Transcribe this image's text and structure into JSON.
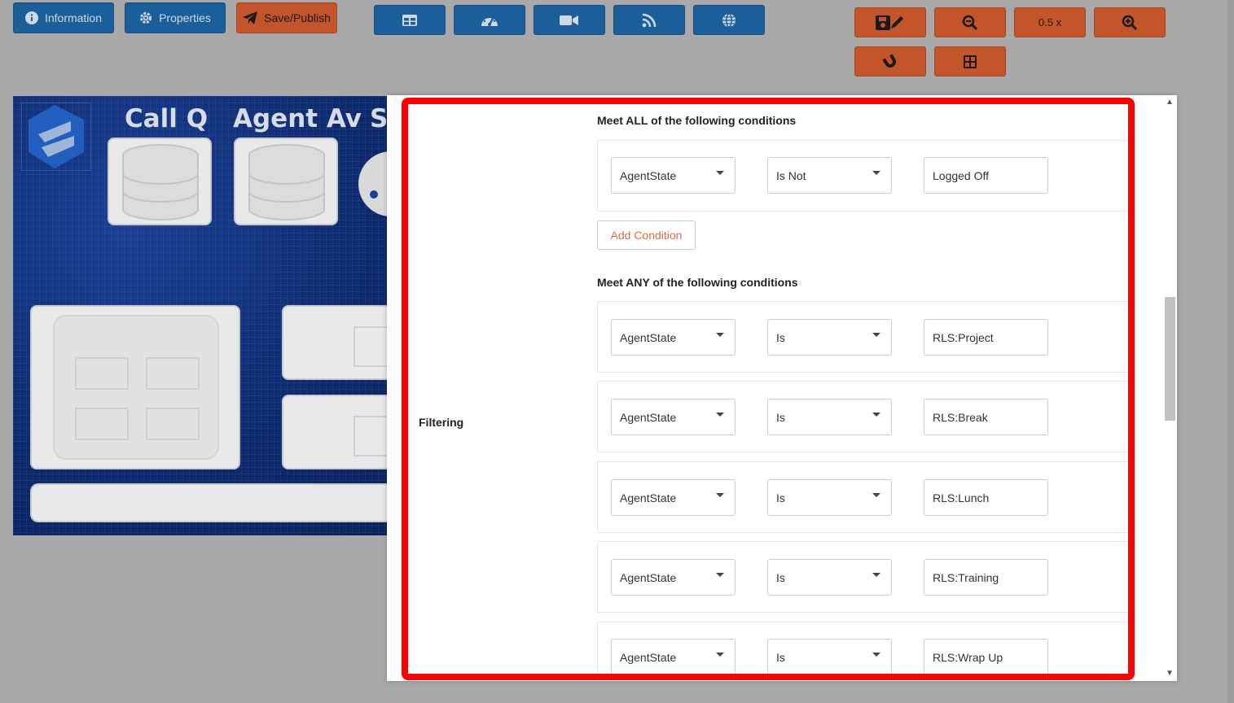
{
  "toolbar": {
    "information_label": "Information",
    "properties_label": "Properties",
    "save_publish_label": "Save/Publish",
    "zoom_level": "0.5 x"
  },
  "canvas": {
    "widget1_title": "Call Q",
    "widget2_title": "Agent Av",
    "widget3_title": "S"
  },
  "modal": {
    "filtering_label": "Filtering",
    "all_heading": "Meet ALL of the following conditions",
    "any_heading": "Meet ANY of the following conditions",
    "add_condition_label": "Add Condition",
    "all_conditions": [
      {
        "field": "AgentState",
        "operator": "Is Not",
        "value": "Logged Off"
      }
    ],
    "any_conditions": [
      {
        "field": "AgentState",
        "operator": "Is",
        "value": "RLS:Project"
      },
      {
        "field": "AgentState",
        "operator": "Is",
        "value": "RLS:Break"
      },
      {
        "field": "AgentState",
        "operator": "Is",
        "value": "RLS:Lunch"
      },
      {
        "field": "AgentState",
        "operator": "Is",
        "value": "RLS:Training"
      },
      {
        "field": "AgentState",
        "operator": "Is",
        "value": "RLS:Wrap Up"
      }
    ]
  },
  "colors": {
    "blue_button": "#1b5f9a",
    "orange_button": "#c4542a",
    "highlight_border": "#ff0000",
    "canvas_background": "#102f7a",
    "add_condition_text": "#e06b4a"
  }
}
